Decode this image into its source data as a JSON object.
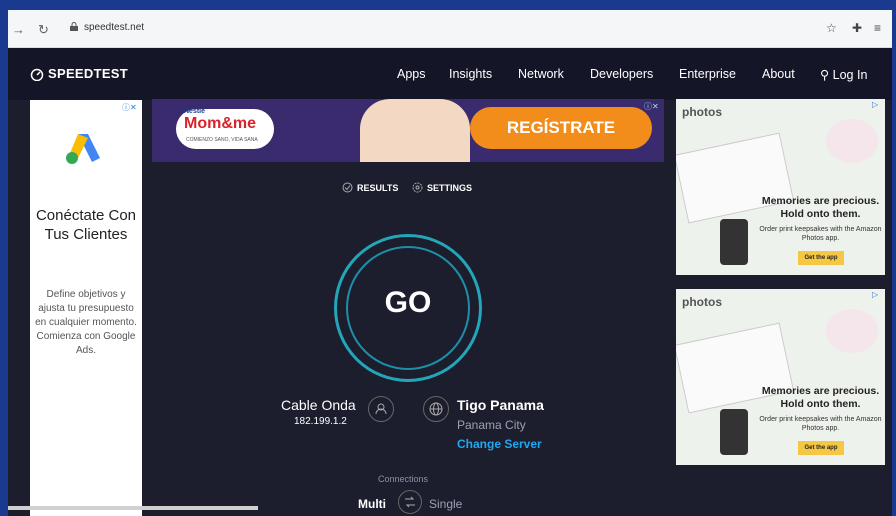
{
  "browser": {
    "url": "speedtest.net"
  },
  "header": {
    "logo": "SPEEDTEST",
    "menu": [
      "Apps",
      "Insights",
      "Network",
      "Developers",
      "Enterprise",
      "About"
    ],
    "login": "Log In"
  },
  "ad_left": {
    "headline": "Conéctate Con Tus Clientes",
    "body": "Define objetivos y ajusta tu presupuesto en cualquier momento. Comienza con Google Ads."
  },
  "banner_ad": {
    "brand_top": "Nestlé",
    "brand": "Mom&me",
    "tagline": "COMIENZO SANO, VIDA SANA",
    "cta": "REGÍSTRATE"
  },
  "tabs": {
    "results": "RESULTS",
    "settings": "SETTINGS"
  },
  "test": {
    "go": "GO"
  },
  "isp": {
    "name": "Cable Onda",
    "ip": "182.199.1.2"
  },
  "server": {
    "name": "Tigo Panama",
    "city": "Panama City",
    "change": "Change Server"
  },
  "connections": {
    "label": "Connections",
    "multi": "Multi",
    "single": "Single"
  },
  "ad_right": {
    "brand": "photos",
    "headline": "Memories are precious. Hold onto them.",
    "body": "Order print keepsakes with the Amazon Photos app.",
    "cta": "Get the app"
  },
  "colors": {
    "accent": "#1ea8f0",
    "ring": "#22a6b8",
    "background": "#1c1e2e"
  }
}
